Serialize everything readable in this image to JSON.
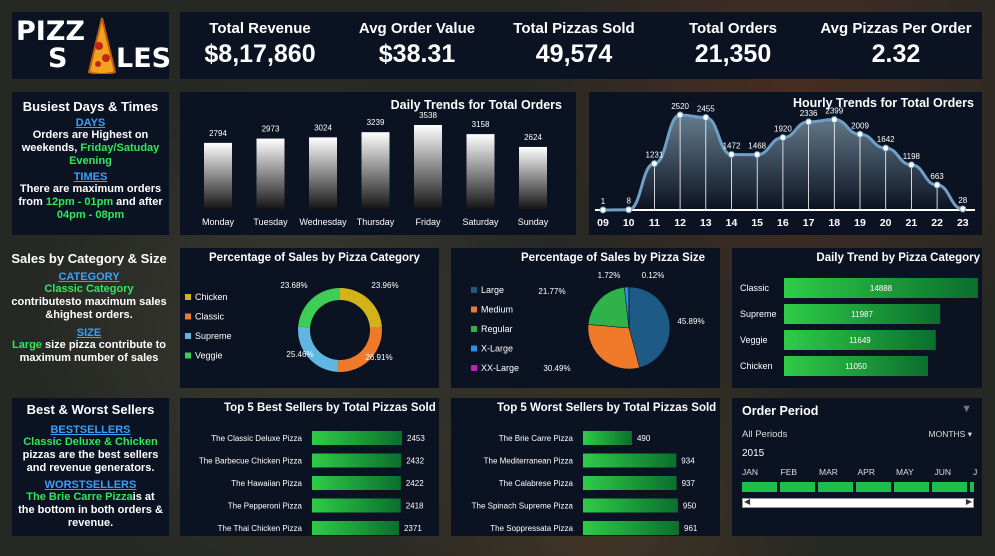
{
  "logo": {
    "line1": "PIZZ",
    "line2a": "S",
    "line2b": "LES"
  },
  "kpis": [
    {
      "title": "Total Revenue",
      "value": "$8,17,860"
    },
    {
      "title": "Avg Order Value",
      "value": "$38.31"
    },
    {
      "title": "Total Pizzas Sold",
      "value": "49,574"
    },
    {
      "title": "Total Orders",
      "value": "21,350"
    },
    {
      "title": "Avg Pizzas Per Order",
      "value": "2.32"
    }
  ],
  "busiest": {
    "title": "Busiest Days  & Times",
    "days_head": "DAYS",
    "days_t1": "Orders are Highest on weekends, ",
    "days_t2": "Friday/Satuday Evening",
    "times_head": "TIMES",
    "times_t1": "There are maximum orders from ",
    "times_t2": "12pm - 01pm",
    "times_t3": " and after ",
    "times_t4": "04pm - 08pm"
  },
  "category_side": {
    "title": "Sales by Category & Size",
    "cat_head": "CATEGORY",
    "cat_t1": "Classic Category",
    "cat_t2": " contributesto maximum sales &highest orders.",
    "size_head": "SIZE",
    "size_t1": "Large",
    "size_t2": " size pizza contribute to maximum  number of sales"
  },
  "bw_side": {
    "title": "Best & Worst Sellers",
    "best_head": "BESTSELLERS",
    "best_t1": "Classic Deluxe & Chicken",
    "best_t2": " pizzas are the best sellers and revenue generators.",
    "worst_head": "WORSTSELLERS",
    "worst_t1": "The Brie Carre Pizza",
    "worst_t2": "is at the bottom in both orders & revenue."
  },
  "chart_data": [
    {
      "type": "bar",
      "title": "Daily Trends for Total Orders",
      "categories": [
        "Monday",
        "Tuesday",
        "Wednesday",
        "Thursday",
        "Friday",
        "Saturday",
        "Sunday"
      ],
      "values": [
        2794,
        2973,
        3024,
        3239,
        3538,
        3158,
        2624
      ]
    },
    {
      "type": "area",
      "title": "Hourly Trends for Total Orders",
      "x": [
        "09",
        "10",
        "11",
        "12",
        "13",
        "14",
        "15",
        "16",
        "17",
        "18",
        "19",
        "20",
        "21",
        "22",
        "23"
      ],
      "values": [
        1,
        8,
        1231,
        2520,
        2455,
        1472,
        1468,
        1920,
        2336,
        2399,
        2009,
        1642,
        1198,
        663,
        28
      ]
    },
    {
      "type": "pie",
      "title": "Percentage of Sales  by  Pizza Category",
      "categories": [
        "Chicken",
        "Classic",
        "Supreme",
        "Veggie"
      ],
      "values": [
        23.96,
        26.91,
        25.46,
        23.68
      ],
      "labels": [
        "23.96%",
        "26.91%",
        "25.46%",
        "23.68%"
      ],
      "colors": [
        "#d4b21a",
        "#ee7a2a",
        "#5fb6e0",
        "#3fce55"
      ]
    },
    {
      "type": "pie",
      "title": "Percentage of Sales  by  Pizza Size",
      "categories": [
        "Large",
        "Medium",
        "Regular",
        "X-Large",
        "XX-Large"
      ],
      "values": [
        45.89,
        30.49,
        21.77,
        1.72,
        0.12
      ],
      "labels": [
        "45.89%",
        "30.49%",
        "21.77%",
        "1.72%",
        "0.12%"
      ],
      "colors": [
        "#1d5a86",
        "#ee7a2a",
        "#2fb24a",
        "#2d8fe0",
        "#c020c0"
      ]
    },
    {
      "type": "bar",
      "title": "Daily Trend by Pizza Category",
      "categories": [
        "Classic",
        "Supreme",
        "Veggie",
        "Chicken"
      ],
      "values": [
        14888,
        11987,
        11649,
        11050
      ]
    },
    {
      "type": "bar",
      "title": "Top 5 Best Sellers by Total Pizzas Sold",
      "categories": [
        "The Classic Deluxe Pizza",
        "The Barbecue Chicken Pizza",
        "The Hawaiian Pizza",
        "The Pepperoni Pizza",
        "The Thai Chicken Pizza"
      ],
      "values": [
        2453,
        2432,
        2422,
        2418,
        2371
      ]
    },
    {
      "type": "bar",
      "title": "Top 5 Worst Sellers by Total Pizzas Sold",
      "categories": [
        "The Brie Carre Pizza",
        "The Mediterranean Pizza",
        "The Calabrese Pizza",
        "The Spinach Supreme Pizza",
        "The Soppressata Pizza"
      ],
      "values": [
        490,
        934,
        937,
        950,
        961
      ]
    }
  ],
  "slicer": {
    "title": "Order Period",
    "all": "All Periods",
    "mode": "MONTHS",
    "year": "2015",
    "months": [
      "JAN",
      "FEB",
      "MAR",
      "APR",
      "MAY",
      "JUN",
      "J"
    ]
  },
  "colors": {
    "panel": "#0b1222",
    "accent_green": "#2ee85a",
    "link_blue": "#3aa0ff"
  }
}
